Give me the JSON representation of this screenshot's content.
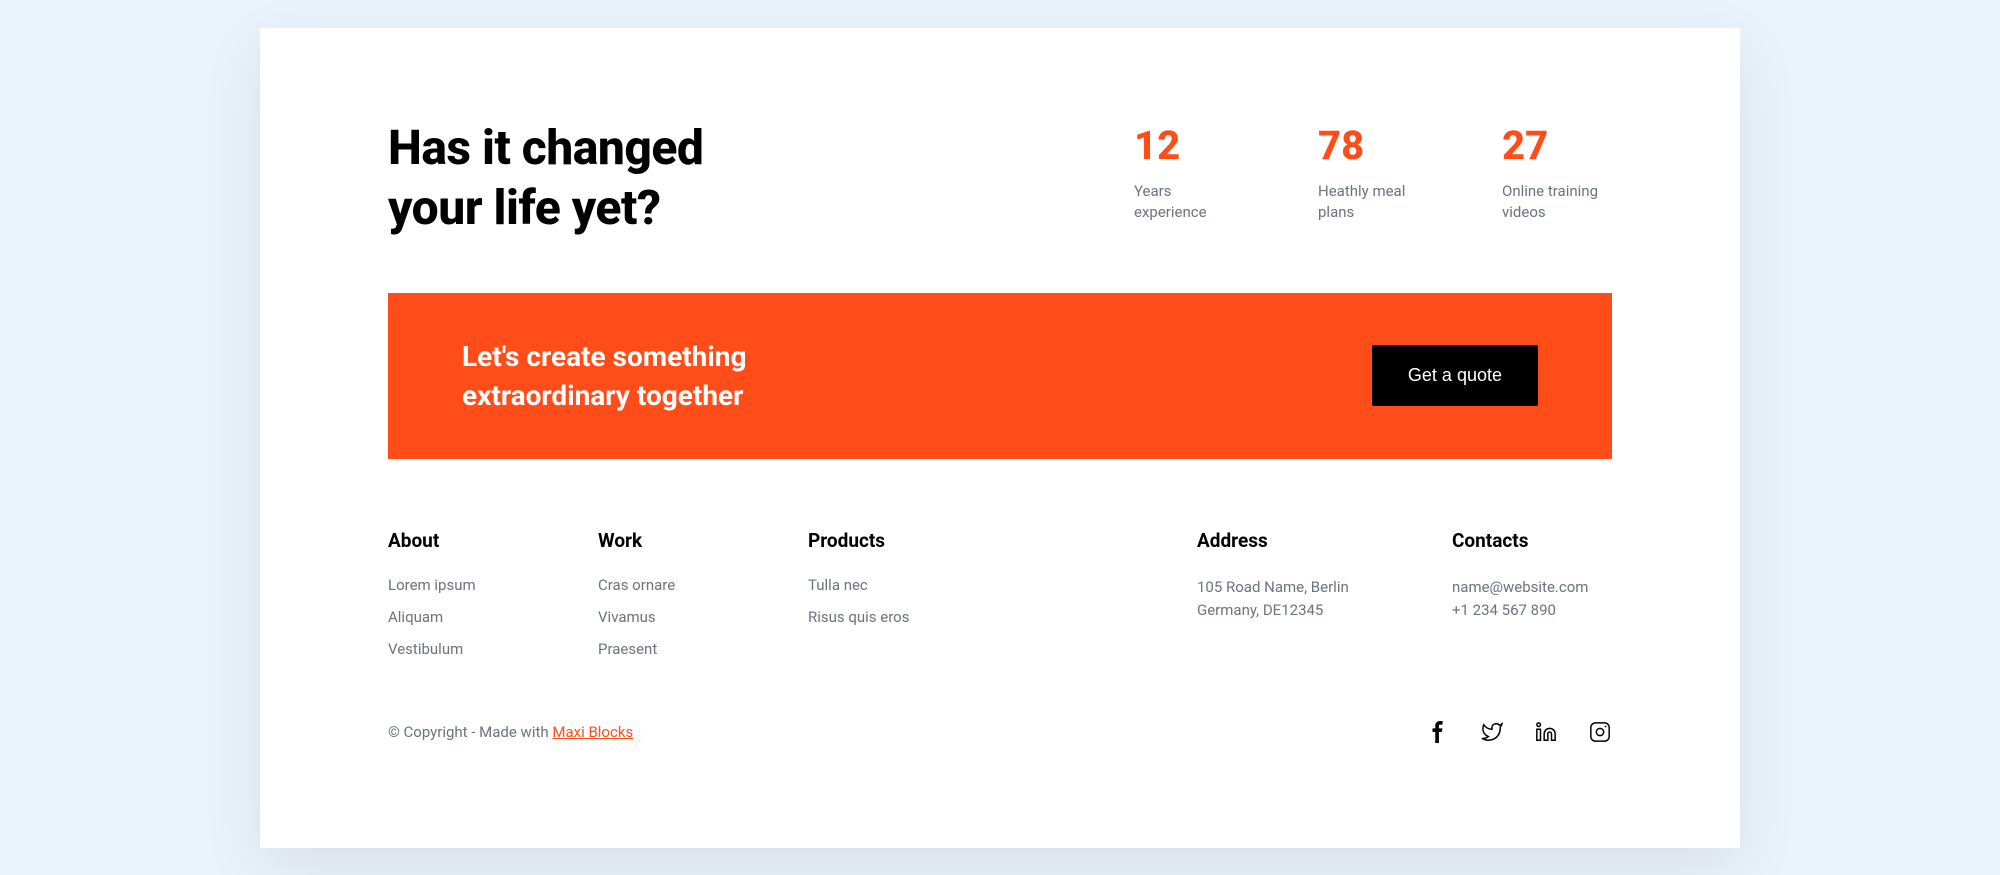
{
  "hero": {
    "headline_line1": "Has it changed",
    "headline_line2": "your life yet?",
    "stats": [
      {
        "value": "12",
        "label": "Years experience"
      },
      {
        "value": "78",
        "label": "Heathly meal plans"
      },
      {
        "value": "27",
        "label": "Online training videos"
      }
    ]
  },
  "cta": {
    "text_line1": "Let's create something",
    "text_line2": "extraordinary together",
    "button": "Get a quote"
  },
  "footer": {
    "about": {
      "title": "About",
      "links": [
        "Lorem ipsum",
        "Aliquam",
        "Vestibulum"
      ]
    },
    "work": {
      "title": "Work",
      "links": [
        "Cras ornare",
        "Vivamus",
        "Praesent"
      ]
    },
    "products": {
      "title": "Products",
      "links": [
        "Tulla nec",
        "Risus quis eros"
      ]
    },
    "address": {
      "title": "Address",
      "line1": "105 Road Name, Berlin",
      "line2": "Germany, DE12345"
    },
    "contacts": {
      "title": "Contacts",
      "email": "name@website.com",
      "phone": "+1 234 567 890"
    }
  },
  "bottom": {
    "copyright_prefix": "© Copyright - Made with ",
    "copyright_link": "Maxi Blocks"
  },
  "social": {
    "facebook": "facebook",
    "twitter": "twitter",
    "linkedin": "linkedin",
    "instagram": "instagram"
  }
}
